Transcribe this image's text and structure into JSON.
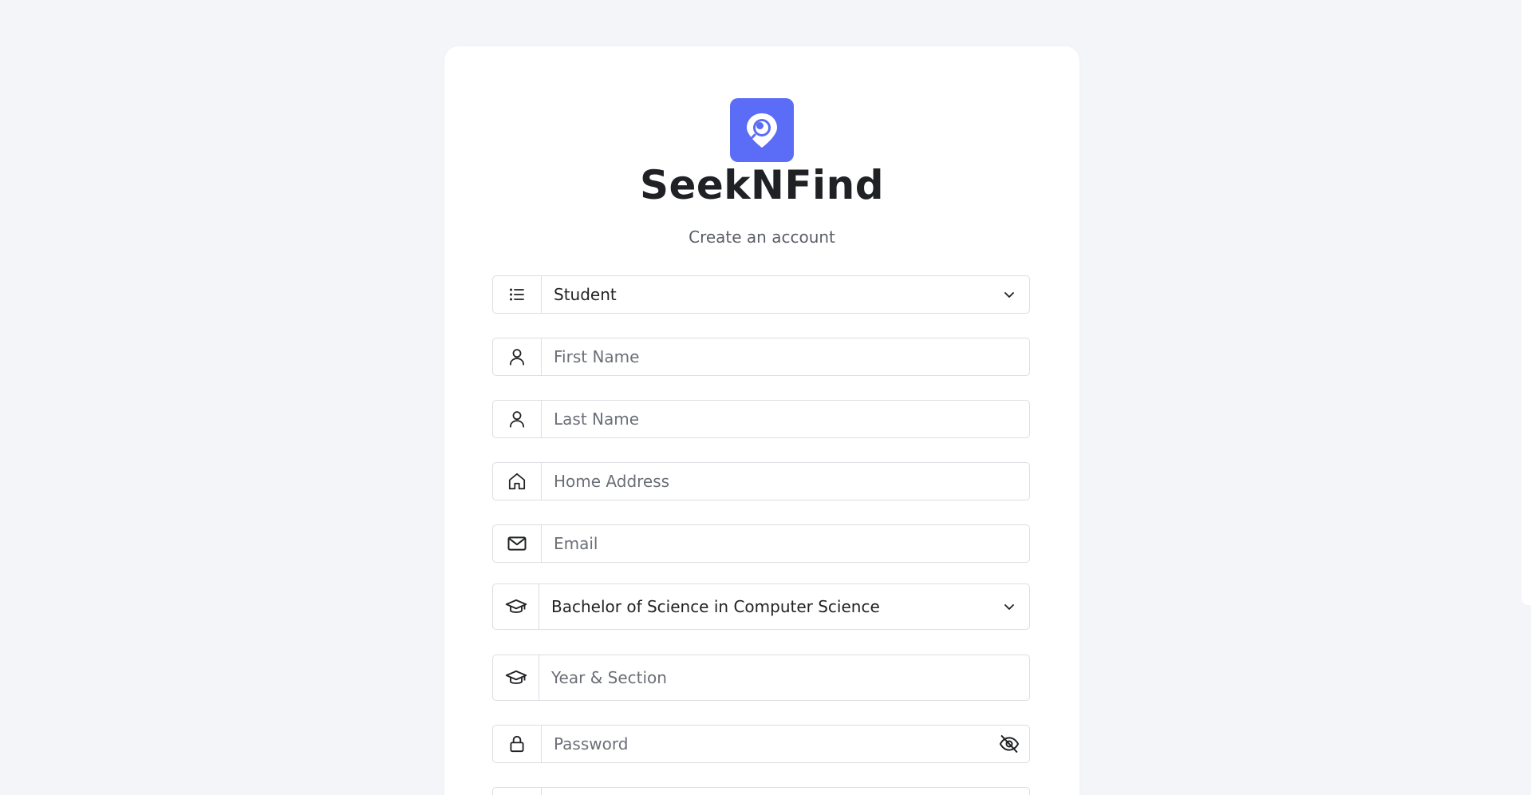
{
  "brand": {
    "name": "SeekNFind",
    "subtitle": "Create an account",
    "logo_icon": "map-pin-search-icon",
    "accent_color": "#5b6cf6"
  },
  "form": {
    "role": {
      "icon": "list-icon",
      "value": "Student"
    },
    "first_name": {
      "icon": "user-icon",
      "placeholder": "First Name"
    },
    "last_name": {
      "icon": "user-icon",
      "placeholder": "Last Name"
    },
    "home_address": {
      "icon": "home-icon",
      "placeholder": "Home Address"
    },
    "email": {
      "icon": "mail-icon",
      "placeholder": "Email"
    },
    "course": {
      "icon": "graduation-cap-icon",
      "value": "Bachelor of Science in Computer Science"
    },
    "year_section": {
      "icon": "graduation-cap-icon",
      "placeholder": "Year & Section"
    },
    "password": {
      "icon": "lock-icon",
      "placeholder": "Password",
      "toggle_icon": "eye-off-icon"
    }
  }
}
